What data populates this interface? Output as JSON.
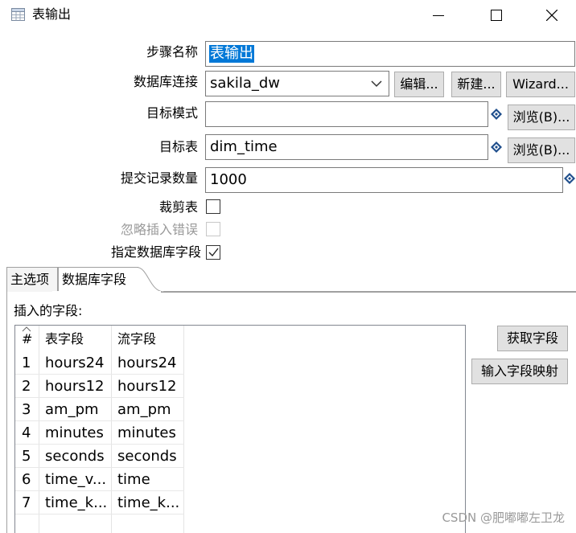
{
  "window": {
    "title": "表输出",
    "controls": {
      "minimize": "—",
      "maximize": "☐",
      "close": "✕"
    }
  },
  "form": {
    "step_name": {
      "label": "步骤名称",
      "value": "表输出"
    },
    "db_connection": {
      "label": "数据库连接",
      "value": "sakila_dw",
      "edit_label": "编辑...",
      "new_label": "新建...",
      "wizard_label": "Wizard..."
    },
    "target_schema": {
      "label": "目标模式",
      "value": "",
      "browse_label": "浏览(B)..."
    },
    "target_table": {
      "label": "目标表",
      "value": "dim_time",
      "browse_label": "浏览(B)..."
    },
    "commit_size": {
      "label": "提交记录数量",
      "value": "1000"
    },
    "truncate_table": {
      "label": "裁剪表",
      "checked": false
    },
    "ignore_insert_errors": {
      "label": "忽略插入错误",
      "checked": false,
      "disabled": true
    },
    "specify_db_fields": {
      "label": "指定数据库字段",
      "checked": true
    }
  },
  "tabs": [
    {
      "label": "主选项",
      "active": false
    },
    {
      "label": "数据库字段",
      "active": true
    }
  ],
  "fields_panel": {
    "section_label": "插入的字段:",
    "get_fields_label": "获取字段",
    "mapping_label": "输入字段映射",
    "columns": [
      "#",
      "表字段",
      "流字段"
    ],
    "rows": [
      {
        "num": "1",
        "table_field": "hours24",
        "stream_field": "hours24"
      },
      {
        "num": "2",
        "table_field": "hours12",
        "stream_field": "hours12"
      },
      {
        "num": "3",
        "table_field": "am_pm",
        "stream_field": "am_pm"
      },
      {
        "num": "4",
        "table_field": "minutes",
        "stream_field": "minutes"
      },
      {
        "num": "5",
        "table_field": "seconds",
        "stream_field": "seconds"
      },
      {
        "num": "6",
        "table_field": "time_v...",
        "stream_field": "time"
      },
      {
        "num": "7",
        "table_field": "time_k...",
        "stream_field": "time_k..."
      }
    ]
  },
  "watermark": "CSDN @肥嘟嘟左卫龙",
  "colors": {
    "selection": "#0078d7",
    "variable_icon": "#1f4e8c",
    "button_bg": "#e1e1e1"
  }
}
